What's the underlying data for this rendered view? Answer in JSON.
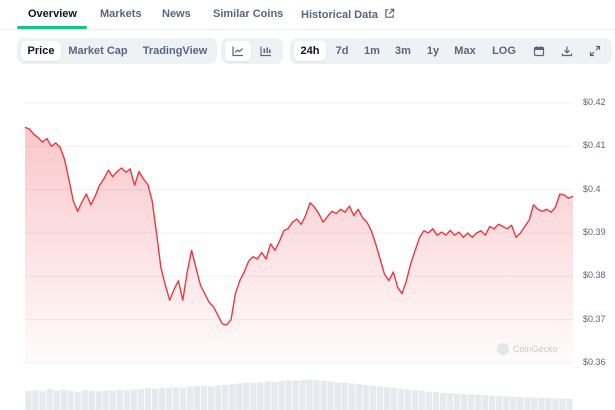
{
  "tabs": [
    {
      "label": "Overview",
      "active": true
    },
    {
      "label": "Markets"
    },
    {
      "label": "News"
    },
    {
      "label": "Similar Coins"
    },
    {
      "label": "Historical Data",
      "icon": "external-link-icon"
    }
  ],
  "toolbar": {
    "view_modes": [
      "Price",
      "Market Cap",
      "TradingView"
    ],
    "active_view": "Price",
    "chart_types": [
      "line-chart-icon",
      "candlestick-chart-icon"
    ],
    "ranges": [
      "24h",
      "7d",
      "1m",
      "3m",
      "1y",
      "Max",
      "LOG"
    ],
    "active_range": "24h",
    "action_icons": [
      "calendar-icon",
      "download-icon",
      "expand-icon"
    ]
  },
  "watermark": "CoinGecko",
  "colors": {
    "line": "#ea3943",
    "fill": "#ea3943",
    "accent": "#16c784",
    "volume": "#e6e9ee"
  },
  "chart_data": {
    "type": "area",
    "y_ticks": [
      "$0.42",
      "$0.41",
      "$0.4",
      "$0.39",
      "$0.38",
      "$0.37",
      "$0.36"
    ],
    "ylim": [
      0.36,
      0.42
    ],
    "grid": true,
    "points": [
      0.4144,
      0.414,
      0.4128,
      0.412,
      0.411,
      0.4118,
      0.41,
      0.4108,
      0.4098,
      0.407,
      0.4025,
      0.3975,
      0.395,
      0.3972,
      0.399,
      0.3965,
      0.3985,
      0.401,
      0.4025,
      0.4045,
      0.403,
      0.4042,
      0.405,
      0.404,
      0.4048,
      0.401,
      0.4042,
      0.4025,
      0.4012,
      0.3975,
      0.39,
      0.382,
      0.378,
      0.3745,
      0.377,
      0.379,
      0.3745,
      0.381,
      0.386,
      0.382,
      0.378,
      0.376,
      0.374,
      0.373,
      0.371,
      0.369,
      0.3688,
      0.37,
      0.376,
      0.379,
      0.381,
      0.3835,
      0.3845,
      0.384,
      0.3855,
      0.384,
      0.3875,
      0.386,
      0.388,
      0.3905,
      0.391,
      0.3925,
      0.3932,
      0.392,
      0.394,
      0.397,
      0.396,
      0.3945,
      0.3925,
      0.3938,
      0.395,
      0.3945,
      0.3955,
      0.3948,
      0.3962,
      0.394,
      0.3955,
      0.3935,
      0.3925,
      0.3905,
      0.3875,
      0.384,
      0.3805,
      0.379,
      0.381,
      0.3775,
      0.376,
      0.379,
      0.383,
      0.386,
      0.389,
      0.3905,
      0.39,
      0.391,
      0.3895,
      0.3902,
      0.3895,
      0.3906,
      0.3895,
      0.3902,
      0.389,
      0.39,
      0.389,
      0.39,
      0.3905,
      0.3895,
      0.3915,
      0.391,
      0.392,
      0.3915,
      0.391,
      0.3918,
      0.389,
      0.39,
      0.3915,
      0.393,
      0.3965,
      0.3955,
      0.395,
      0.3955,
      0.3948,
      0.396,
      0.399,
      0.3988,
      0.398,
      0.3985
    ],
    "volume": [
      0.5,
      0.52,
      0.49,
      0.55,
      0.51,
      0.53,
      0.5,
      0.48,
      0.52,
      0.5,
      0.49,
      0.51,
      0.5,
      0.53,
      0.52,
      0.54,
      0.55,
      0.57,
      0.56,
      0.58,
      0.59,
      0.6,
      0.58,
      0.62,
      0.63,
      0.64,
      0.62,
      0.65,
      0.66,
      0.68,
      0.7,
      0.72,
      0.71,
      0.73,
      0.75,
      0.74,
      0.76,
      0.78,
      0.77,
      0.79,
      0.8,
      0.78,
      0.77,
      0.75,
      0.73,
      0.72,
      0.7,
      0.68,
      0.66,
      0.64,
      0.62,
      0.6,
      0.58,
      0.56,
      0.54,
      0.52,
      0.5,
      0.48,
      0.47,
      0.45,
      0.44,
      0.43,
      0.42,
      0.41,
      0.4,
      0.39,
      0.38,
      0.37,
      0.36,
      0.35,
      0.34,
      0.33,
      0.33,
      0.32,
      0.31,
      0.3,
      0.3,
      0.29
    ]
  }
}
